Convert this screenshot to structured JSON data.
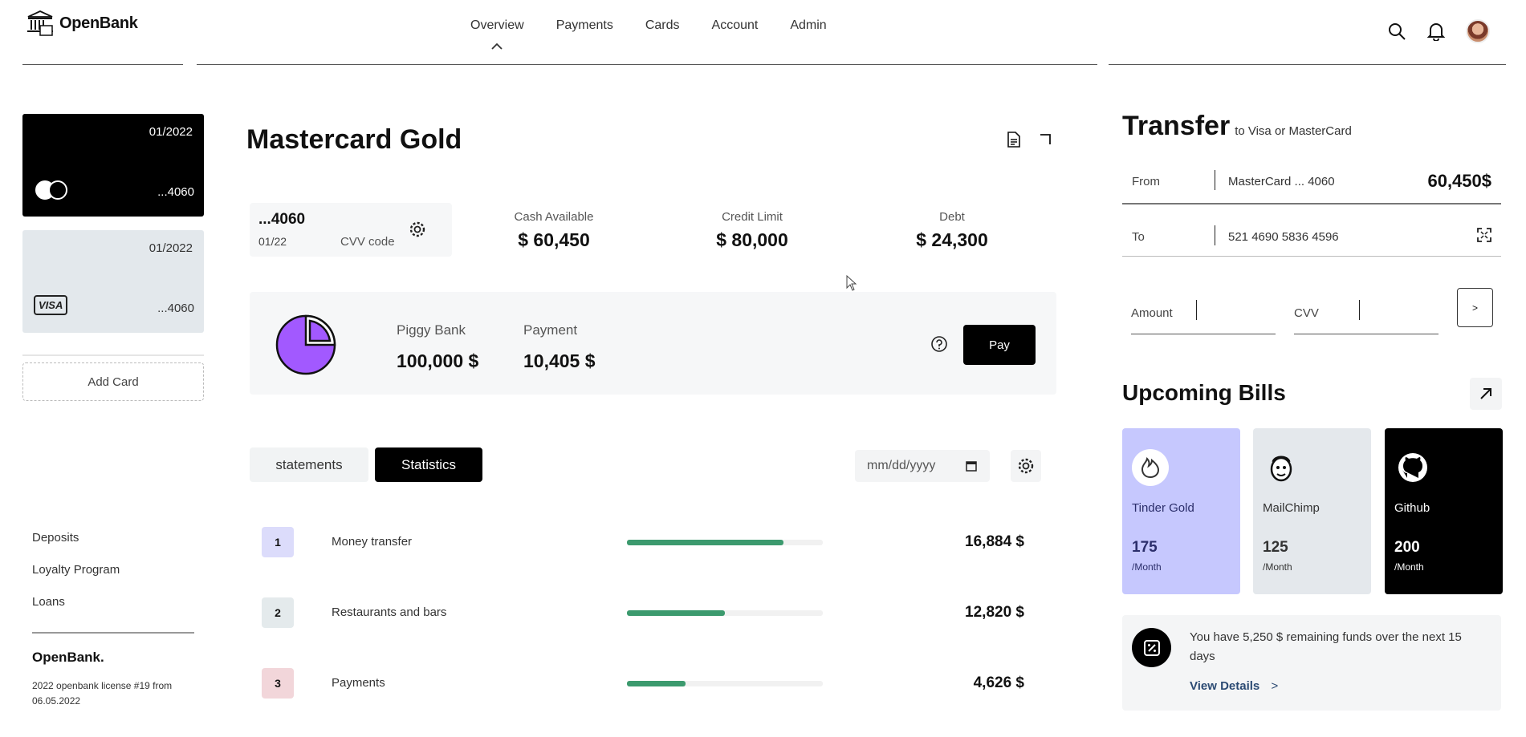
{
  "header": {
    "brand": "OpenBank",
    "nav": [
      "Overview",
      "Payments",
      "Cards",
      "Account",
      "Admin"
    ],
    "active_nav": "Overview"
  },
  "cards": [
    {
      "expiry": "01/2022",
      "number": "...4060",
      "network": "mastercard",
      "color": "#000000"
    },
    {
      "expiry": "01/2022",
      "number": "...4060",
      "network": "VISA",
      "color": "#e3e8ec"
    }
  ],
  "add_card_label": "Add Card",
  "side_links": [
    "Deposits",
    "Loyalty Program",
    "Loans"
  ],
  "footer": {
    "brand": "OpenBank.",
    "license": "2022 openbank license #19 from 06.05.2022"
  },
  "main": {
    "title": "Mastercard Gold",
    "card_summary": {
      "number": "...4060",
      "expiry": "01/22",
      "cvv_label": "CVV code"
    },
    "stats": [
      {
        "label": "Cash Available",
        "value": "$ 60,450"
      },
      {
        "label": "Credit Limit",
        "value": "$ 80,000"
      },
      {
        "label": "Debt",
        "value": "$ 24,300"
      }
    ],
    "piggy": {
      "piggy_label": "Piggy Bank",
      "piggy_value": "100,000 $",
      "payment_label": "Payment",
      "payment_value": "10,405 $",
      "pay_button": "Pay",
      "pie_color": "#a259ff"
    },
    "tabs": [
      {
        "label": "statements",
        "active": false
      },
      {
        "label": "Statistics",
        "active": true
      }
    ],
    "date_placeholder": "mm/dd/yyyy",
    "rows": [
      {
        "index": "1",
        "label": "Money transfer",
        "amount": "16,884 $",
        "progress": 0.8,
        "index_bg": "#dcdcfb"
      },
      {
        "index": "2",
        "label": "Restaurants and bars",
        "amount": "12,820 $",
        "progress": 0.5,
        "index_bg": "#e4eaec"
      },
      {
        "index": "3",
        "label": "Payments",
        "amount": "4,626 $",
        "progress": 0.3,
        "index_bg": "#f2d6da"
      }
    ],
    "accent_color": "#3c9a6e"
  },
  "transfer": {
    "title": "Transfer",
    "subtitle": "to Visa or MasterCard",
    "from_label": "From",
    "from_value": "MasterCard ... 4060",
    "from_amount": "60,450$",
    "to_label": "To",
    "to_value": "521 4690 5836 4596",
    "amount_label": "Amount",
    "cvv_label": "CVV",
    "submit_label": ">"
  },
  "bills": {
    "title": "Upcoming Bills",
    "items": [
      {
        "name": "Tinder Gold",
        "amount": "175",
        "period": "/Month",
        "icon": "tinder-icon"
      },
      {
        "name": "MailChimp",
        "amount": "125",
        "period": "/Month",
        "icon": "mailchimp-icon"
      },
      {
        "name": "Github",
        "amount": "200",
        "period": "/Month",
        "icon": "github-icon"
      }
    ],
    "notice": "You have 5,250 $ remaining funds over the next 15 days",
    "view_details": "View Details",
    "view_details_arrow": ">"
  }
}
